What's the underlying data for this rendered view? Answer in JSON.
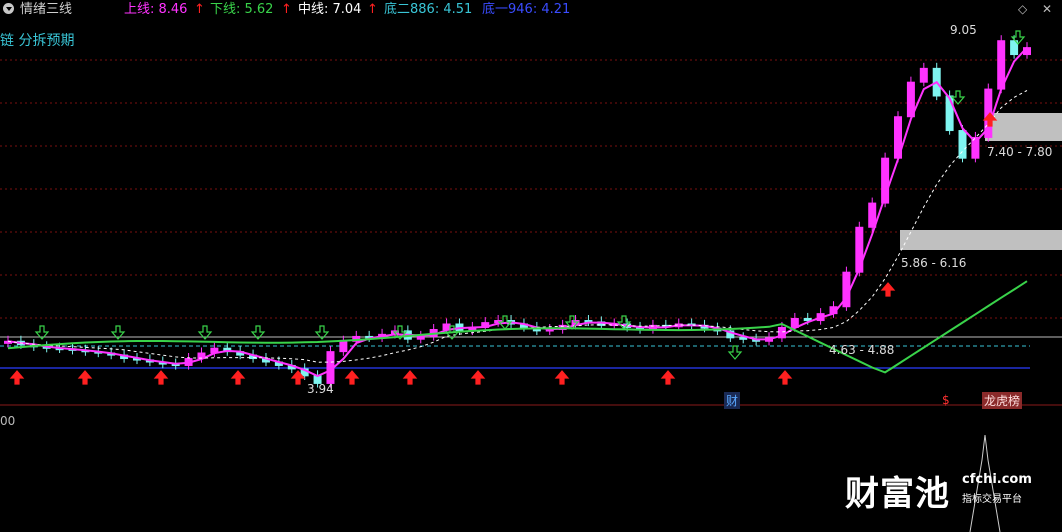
{
  "header": {
    "title": "情绪三线",
    "up_line": "上线: 8.46",
    "down_line": "下线: 5.62",
    "mid_line": "中线: 7.04",
    "bottom2": "底二886: 4.51",
    "bottom1": "底一946: 4.21",
    "subtitle": "链 分拆预期"
  },
  "price_labels": {
    "high": "9.05",
    "low": "3.94",
    "zone_top": "7.40 - 7.80",
    "zone_mid": "5.86 - 6.16",
    "zone_low": "4.63 - 4.88"
  },
  "event_tags": {
    "cai": "财",
    "s": "$",
    "bang": "龙虎榜"
  },
  "sub_panel": {
    "axis_label": "00"
  },
  "watermark": {
    "brand": "财富池",
    "site": "cfchi.com",
    "tagline": "指标交易平台"
  },
  "colors": {
    "up_line": "#ff33ff",
    "down_line": "#39d34a",
    "mid_line": "#ffffff",
    "bottom2": "#39c5d6",
    "bottom1": "#2a3cff",
    "bull_candle": "#ff33ff",
    "bear_candle": "#7ff5f0",
    "grid": "#7a1010",
    "zone_box": "#c0c0c0"
  },
  "chart_data": {
    "type": "candlestick",
    "y_range": [
      3.7,
      9.2
    ],
    "closes": [
      4.55,
      4.5,
      4.47,
      4.45,
      4.44,
      4.42,
      4.4,
      4.38,
      4.35,
      4.3,
      4.28,
      4.25,
      4.22,
      4.2,
      4.3,
      4.38,
      4.45,
      4.4,
      4.35,
      4.3,
      4.25,
      4.2,
      4.15,
      4.05,
      3.94,
      4.4,
      4.55,
      4.62,
      4.6,
      4.65,
      4.7,
      4.58,
      4.62,
      4.72,
      4.8,
      4.7,
      4.75,
      4.82,
      4.85,
      4.8,
      4.75,
      4.7,
      4.72,
      4.78,
      4.85,
      4.83,
      4.78,
      4.8,
      4.75,
      4.72,
      4.78,
      4.76,
      4.8,
      4.78,
      4.74,
      4.7,
      4.6,
      4.58,
      4.55,
      4.6,
      4.75,
      4.88,
      4.85,
      4.95,
      5.05,
      5.55,
      6.2,
      6.55,
      7.2,
      7.8,
      8.3,
      8.5,
      8.1,
      7.6,
      7.2,
      7.5,
      8.2,
      8.9,
      8.7,
      8.8
    ]
  }
}
